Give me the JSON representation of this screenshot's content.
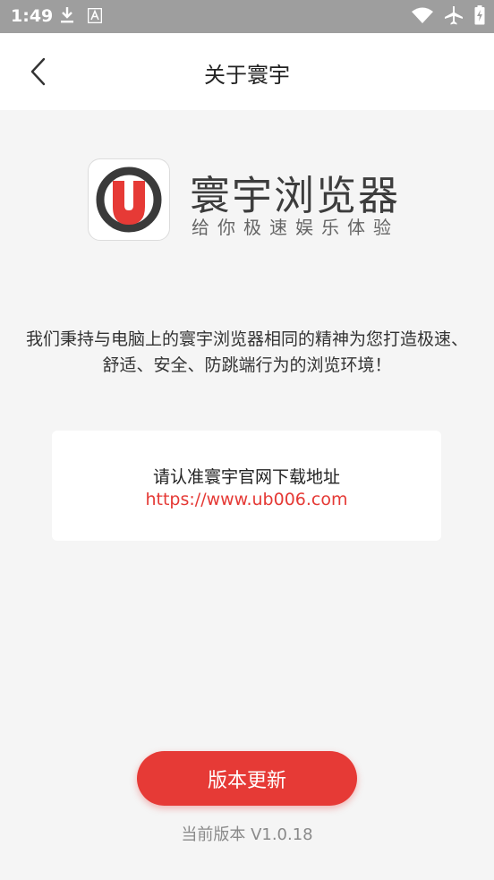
{
  "status_bar": {
    "time": "1:49",
    "icons": [
      "download-icon",
      "font-icon",
      "wifi-icon",
      "airplane-icon",
      "battery-charging-icon"
    ]
  },
  "header": {
    "title": "关于寰宇",
    "back_icon": "chevron-left-icon"
  },
  "brand": {
    "logo_icon": "u-logo-icon",
    "logo_letter": "U",
    "name": "寰宇浏览器",
    "slogan": "给你极速娱乐体验",
    "colors": {
      "logo_red": "#e63a36",
      "logo_ring": "#3a3a3a"
    }
  },
  "description": "我们秉持与电脑上的寰宇浏览器相同的精神为您打造极速、舒适、安全、防跳端行为的浏览环境！",
  "url_card": {
    "label": "请认准寰宇官网下载地址",
    "url": "https://www.ub006.com"
  },
  "actions": {
    "update_label": "版本更新"
  },
  "version": {
    "text": "当前版本 V1.0.18"
  },
  "colors": {
    "accent": "#e63a36",
    "status_bar": "#9e9e9e",
    "background": "#f5f5f5"
  }
}
